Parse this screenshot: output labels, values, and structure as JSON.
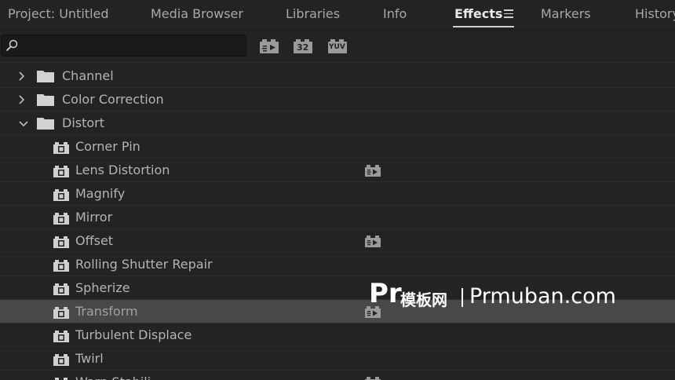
{
  "tabs": [
    {
      "label": "Project: Untitled"
    },
    {
      "label": "Media Browser"
    },
    {
      "label": "Libraries"
    },
    {
      "label": "Info"
    },
    {
      "label": "Effects",
      "active": true
    },
    {
      "label": "Markers"
    },
    {
      "label": "History"
    }
  ],
  "search": {
    "value": "",
    "placeholder": ""
  },
  "toolbar": {
    "accelerated_icon": "accelerated-effects-icon",
    "bit32_label": "32",
    "yuv_label": "YUV"
  },
  "tree": {
    "folders": [
      {
        "label": "Channel",
        "expanded": false
      },
      {
        "label": "Color Correction",
        "expanded": false
      },
      {
        "label": "Distort",
        "expanded": true
      }
    ],
    "effects": [
      {
        "label": "Corner Pin",
        "accelerated": false
      },
      {
        "label": "Lens Distortion",
        "accelerated": true
      },
      {
        "label": "Magnify",
        "accelerated": false
      },
      {
        "label": "Mirror",
        "accelerated": false
      },
      {
        "label": "Offset",
        "accelerated": true
      },
      {
        "label": "Rolling Shutter Repair",
        "accelerated": false
      },
      {
        "label": "Spherize",
        "accelerated": false
      },
      {
        "label": "Transform",
        "accelerated": true,
        "selected": true
      },
      {
        "label": "Turbulent Displace",
        "accelerated": false
      },
      {
        "label": "Twirl",
        "accelerated": false
      },
      {
        "label": "Warp Stabili",
        "accelerated": true
      }
    ]
  },
  "watermark": {
    "logo": "Pr",
    "cn_text": "模板网",
    "site": "Prmuban.com"
  },
  "colors": {
    "background": "#232323",
    "selected_row": "#484848",
    "text": "#b4b4b4"
  }
}
